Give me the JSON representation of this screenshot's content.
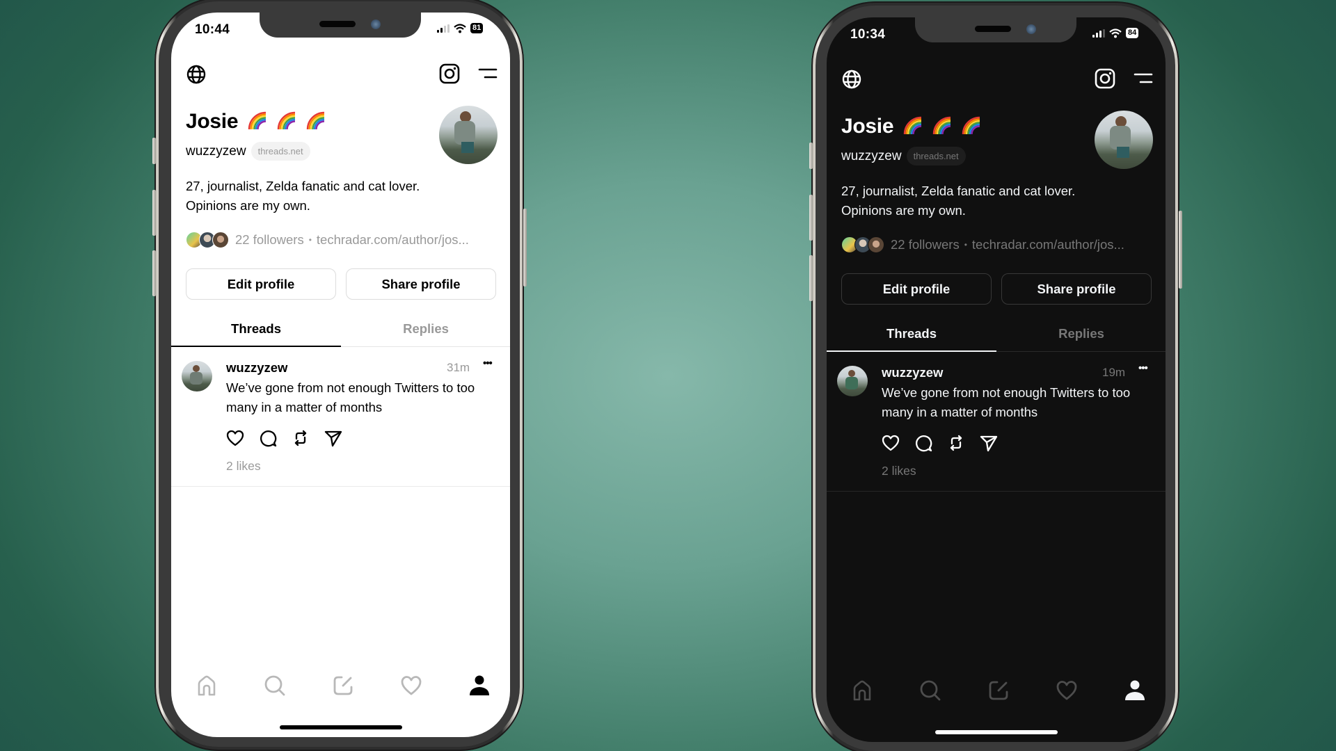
{
  "phones": [
    {
      "theme": "light",
      "status_bar": {
        "time": "10:44",
        "battery": "81",
        "signal_icon": "cellular-signal-icon",
        "wifi_icon": "wifi-icon"
      },
      "header": {
        "globe_icon": "globe-icon",
        "instagram_icon": "instagram-icon",
        "menu_icon": "menu-icon"
      },
      "profile": {
        "name": "Josie",
        "name_emoji": "rainbow-emoji x3",
        "username": "wuzzyzew",
        "domain_badge": "threads.net",
        "bio_line1": "27, journalist, Zelda fanatic and cat lover.",
        "bio_line2": "Opinions are my own.",
        "followers": "22 followers",
        "separator": "•",
        "link": "techradar.com/author/jos..."
      },
      "buttons": {
        "edit": "Edit profile",
        "share": "Share profile"
      },
      "tabs": [
        {
          "label": "Threads",
          "active": true
        },
        {
          "label": "Replies",
          "active": false
        }
      ],
      "post": {
        "author": "wuzzyzew",
        "time": "31m",
        "more": "•••",
        "text_line1": "We’ve gone from not enough Twitters to too",
        "text_line2": "many in a matter of months",
        "likes": "2 likes"
      },
      "nav": [
        "home-icon",
        "search-icon",
        "compose-icon",
        "activity-heart-icon",
        "profile-icon"
      ],
      "active_nav": "profile"
    },
    {
      "theme": "dark",
      "status_bar": {
        "time": "10:34",
        "battery": "84",
        "signal_icon": "cellular-signal-icon",
        "wifi_icon": "wifi-icon"
      },
      "header": {
        "globe_icon": "globe-icon",
        "instagram_icon": "instagram-icon",
        "menu_icon": "menu-icon"
      },
      "profile": {
        "name": "Josie",
        "name_emoji": "rainbow-emoji x3",
        "username": "wuzzyzew",
        "domain_badge": "threads.net",
        "bio_line1": "27, journalist, Zelda fanatic and cat lover.",
        "bio_line2": "Opinions are my own.",
        "followers": "22 followers",
        "separator": "•",
        "link": "techradar.com/author/jos..."
      },
      "buttons": {
        "edit": "Edit profile",
        "share": "Share profile"
      },
      "tabs": [
        {
          "label": "Threads",
          "active": true
        },
        {
          "label": "Replies",
          "active": false
        }
      ],
      "post": {
        "author": "wuzzyzew",
        "time": "19m",
        "more": "•••",
        "text_line1": "We’ve gone from not enough Twitters to too",
        "text_line2": "many in a matter of months",
        "likes": "2 likes"
      },
      "nav": [
        "home-icon",
        "search-icon",
        "compose-icon",
        "activity-heart-icon",
        "profile-icon"
      ],
      "active_nav": "profile"
    }
  ],
  "colors": {
    "background_center": "#86b8aa",
    "background_edge": "#22574a",
    "light_text": "#000000",
    "light_secondary": "#999999",
    "dark_bg": "#101010",
    "dark_text": "#f3f5f7",
    "dark_secondary": "#777777"
  }
}
